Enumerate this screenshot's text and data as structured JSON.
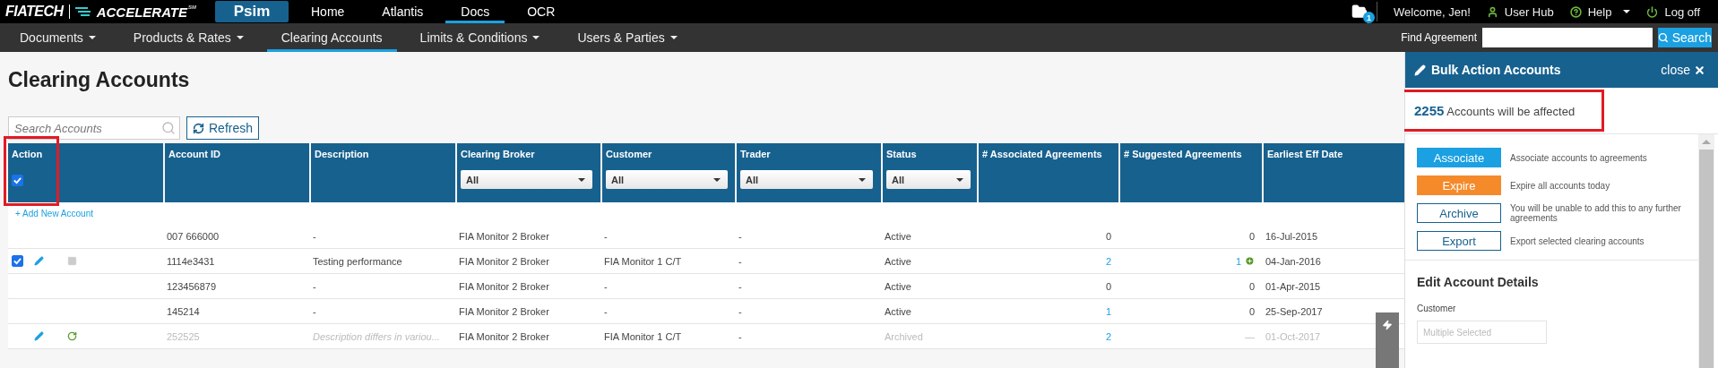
{
  "logo": {
    "brand": "FIATECH",
    "product": "ACCELERATE",
    "mark": "SM"
  },
  "app_tab": {
    "label": "Psim"
  },
  "nav": [
    {
      "label": "Home",
      "selected": false
    },
    {
      "label": "Atlantis",
      "selected": false
    },
    {
      "label": "Docs",
      "selected": true
    },
    {
      "label": "OCR",
      "selected": false
    }
  ],
  "user_bar": {
    "notifications": "1",
    "welcome": "Welcome, Jen!",
    "links": [
      {
        "kind": "user",
        "label": "User Hub"
      },
      {
        "kind": "help",
        "label": "Help",
        "dropdown": true
      },
      {
        "kind": "power",
        "label": "Log off"
      }
    ]
  },
  "menu": [
    {
      "label": "Documents",
      "dropdown": true,
      "selected": false
    },
    {
      "label": "Products & Rates",
      "dropdown": true,
      "selected": false
    },
    {
      "label": "Clearing Accounts",
      "dropdown": false,
      "selected": true
    },
    {
      "label": "Limits & Conditions",
      "dropdown": true,
      "selected": false
    },
    {
      "label": "Users & Parties",
      "dropdown": true,
      "selected": false
    }
  ],
  "find_agreement": {
    "label": "Find Agreement",
    "button": "Search"
  },
  "page_title": "Clearing Accounts",
  "search": {
    "placeholder": "Search Accounts"
  },
  "refresh_button": "Refresh",
  "table": {
    "columns": [
      {
        "label": "Action",
        "checked": true,
        "highlighted": true
      },
      {
        "label": "Account ID"
      },
      {
        "label": "Description"
      },
      {
        "label": "Clearing Broker",
        "filter": "All"
      },
      {
        "label": "Customer",
        "filter": "All"
      },
      {
        "label": "Trader",
        "filter": "All"
      },
      {
        "label": "Status",
        "filter": "All"
      },
      {
        "label": "# Associated Agreements"
      },
      {
        "label": "# Suggested Agreements"
      },
      {
        "label": "Earliest Eff Date"
      }
    ],
    "add_link": "+ Add New Account",
    "rows": [
      {
        "checked": false,
        "actions": [],
        "archived": false,
        "account": "007 666000",
        "description": "-",
        "broker": "FIA Monitor 2 Broker",
        "customer": "-",
        "trader": "-",
        "status": "Active",
        "associated": {
          "text": "0",
          "link": false
        },
        "suggested": {
          "text": "0",
          "link": false,
          "add": false
        },
        "date": "16-Jul-2015"
      },
      {
        "checked": true,
        "actions": [
          {
            "kind": "edit"
          },
          {
            "kind": "archive"
          }
        ],
        "archived": false,
        "account": "1114e3431",
        "description": "Testing performance",
        "broker": "FIA Monitor 2 Broker",
        "customer": "FIA Monitor 1 C/T",
        "trader": "-",
        "status": "Active",
        "associated": {
          "text": "2",
          "link": true
        },
        "suggested": {
          "text": "1",
          "link": true,
          "add": true
        },
        "date": "04-Jan-2016"
      },
      {
        "checked": false,
        "actions": [],
        "archived": false,
        "account": "123456879",
        "description": "-",
        "broker": "FIA Monitor 2 Broker",
        "customer": "-",
        "trader": "-",
        "status": "Active",
        "associated": {
          "text": "0",
          "link": false
        },
        "suggested": {
          "text": "0",
          "link": false,
          "add": false
        },
        "date": "01-Apr-2015"
      },
      {
        "checked": false,
        "actions": [],
        "archived": false,
        "account": "145214",
        "description": "-",
        "broker": "FIA Monitor 2 Broker",
        "customer": "-",
        "trader": "-",
        "status": "Active",
        "associated": {
          "text": "1",
          "link": true
        },
        "suggested": {
          "text": "0",
          "link": false,
          "add": false
        },
        "date": "25-Sep-2017"
      },
      {
        "checked": false,
        "actions": [
          {
            "kind": "edit"
          },
          {
            "kind": "restore"
          }
        ],
        "archived": true,
        "account": "252525",
        "description": "Description differs in variou...",
        "broker": "FIA Monitor 2 Broker",
        "customer": "FIA Monitor 1 C/T",
        "trader": "-",
        "status": "Archived",
        "associated": {
          "text": "2",
          "link": true
        },
        "suggested": {
          "text": "—",
          "link": false,
          "add": false
        },
        "date": "01-Oct-2017"
      }
    ]
  },
  "panel": {
    "title": "Bulk Action Accounts",
    "close": "close",
    "summary": "**2255** Accounts will be affected",
    "summary_highlighted": true,
    "actions": [
      {
        "kind": "primary",
        "label": "Associate",
        "description": "Associate accounts to agreements"
      },
      {
        "kind": "warning",
        "label": "Expire",
        "description": "Expire all accounts today"
      },
      {
        "kind": "outline",
        "label": "Archive",
        "description": "You will be unable to add this to any further agreements"
      },
      {
        "kind": "outline",
        "label": "Export",
        "description": "Export selected clearing accounts"
      }
    ],
    "section_title": "Edit Account Details",
    "customer_label": "Customer",
    "customer_placeholder": "Multiple Selected"
  }
}
